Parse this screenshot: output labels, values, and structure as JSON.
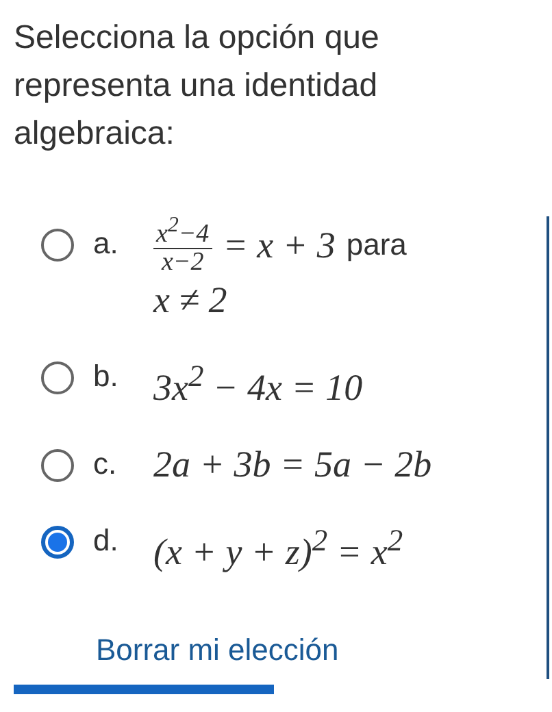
{
  "question": "Selecciona la opción que representa una identidad algebraica:",
  "options": [
    {
      "kind": "fraction",
      "letter": "a.",
      "selected": false,
      "numerator": "x$^{2}$−4",
      "denominator": "x−2",
      "rest": "= x + 3",
      "suffix": "para",
      "second_line": "x ≠ 2"
    },
    {
      "kind": "equation",
      "letter": "b.",
      "selected": false,
      "text": "3x$^{2}$ − 4x = 10"
    },
    {
      "kind": "equation",
      "letter": "c.",
      "selected": false,
      "text": "2a + 3b = 5a − 2b"
    },
    {
      "kind": "equation",
      "letter": "d.",
      "selected": true,
      "text": "(x + y + z)$^{2}$ = x$^{2}$"
    }
  ],
  "clear_button": "Borrar mi elección"
}
